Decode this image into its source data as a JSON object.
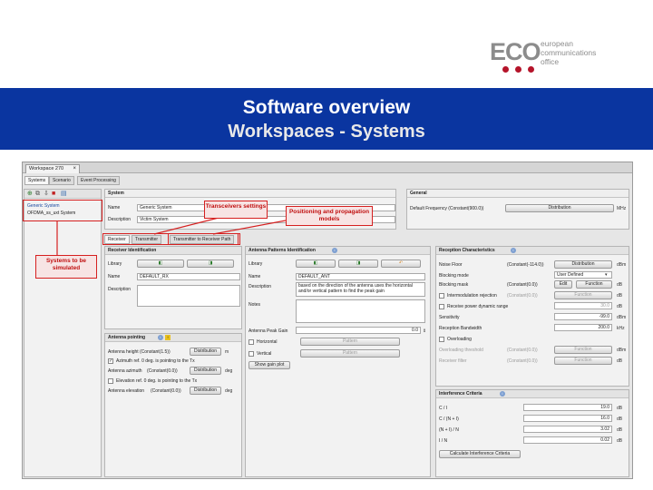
{
  "logo": {
    "mark": "ECO",
    "text_lines": [
      "european",
      "communications",
      "office"
    ],
    "brand_color": "#b5142a"
  },
  "banner": {
    "title": "Software overview",
    "subtitle": "Workspaces - Systems",
    "background_color": "#0a35a0"
  },
  "app": {
    "workspace_tab": "Workspace 270",
    "sub_tabs": [
      "Systems",
      "Scenario",
      "Event Processing"
    ],
    "systems_list": [
      "Generic System",
      "OFDMA_ss_uxt System"
    ],
    "system": {
      "header": "System",
      "name_label": "Name",
      "name_value": "Generic System",
      "description_label": "Description",
      "description_value": "Victim System"
    },
    "general": {
      "header": "General",
      "default_frequency_label": "Default Frequency (Constant(900.0))",
      "distribution_btn": "Distribution",
      "unit": "MHz"
    },
    "tabs": [
      "Receiver",
      "Transmitter",
      "Transmitter to Receiver Path"
    ],
    "receiver_identification": {
      "header": "Receiver Identification",
      "library_label": "Library",
      "name_label": "Name",
      "name_value": "DEFAULT_RX",
      "description_label": "Description"
    },
    "antenna_pattern": {
      "header": "Antenna Patterns Identification",
      "library_label": "Library",
      "name_label": "Name",
      "name_value": "DEFAULT_ANT",
      "description_label": "Description",
      "description_text": "based on the direction of the antenna uses the horizontal and/or vertical pattern to find the peak gain",
      "notes_label": "Notes",
      "peak_gain_label": "Antenna Peak Gain",
      "peak_gain_value": "0.0",
      "horizontal_label": "Horizontal",
      "vertical_label": "Vertical",
      "pattern_btn": "Pattern",
      "show_gain_btn": "Show gain plot"
    },
    "antenna_pointing": {
      "header": "Antenna pointing",
      "height_label": "Antenna height",
      "height_const": "(Constant(1.5))",
      "distribution_btn": "Distribution",
      "height_unit": "m",
      "azimuth_ref_label": "Azimuth ref. 0 deg. is pointing to the Tx",
      "azimuth_label": "Antenna azimuth",
      "azimuth_const": "(Constant(0.0))",
      "azimuth_unit": "deg",
      "elevation_ref_label": "Elevation ref. 0 deg. is pointing to the Tx",
      "elevation_label": "Antenna elevation",
      "elevation_const": "(Constant(0.0))",
      "elevation_unit": "deg"
    },
    "reception": {
      "header": "Reception Characteristics",
      "noise_floor_label": "Noise Floor",
      "noise_floor_const": "(Constant(-114.0))",
      "distribution_btn": "Distribution",
      "noise_floor_unit": "dBm",
      "blocking_mode_label": "Blocking mode",
      "blocking_mode_value": "User Defined",
      "blocking_mask_label": "Blocking mask",
      "blocking_mask_const": "(Constant(0.0))",
      "edit_btn": "Edit",
      "function_btn": "Function",
      "blocking_unit": "dB",
      "intermod_label": "Intermodulation rejection",
      "intermod_const": "(Constant(0.0))",
      "intermod_unit": "dB",
      "rx_power_label": "Receive power dynamic range",
      "rx_power_value": "30.0",
      "rx_power_unit": "dB",
      "sensitivity_label": "Sensitivity",
      "sensitivity_value": "-99.0",
      "sensitivity_unit": "dBm",
      "bandwidth_label": "Reception Bandwidth",
      "bandwidth_value": "200.0",
      "bandwidth_unit": "kHz",
      "overloading_label": "Overloading",
      "overload_threshold_label": "Overloading threshold",
      "overload_threshold_const": "(Constant(0.0))",
      "overload_unit": "dBm",
      "receiver_filter_label": "Receiver filter",
      "receiver_filter_const": "(Constant(0.0))",
      "filter_unit": "dB"
    },
    "interference": {
      "header": "Interference Criteria",
      "ci_label": "C / I",
      "ci_value": "19.0",
      "cni_label": "C / (N + I)",
      "cni_value": "16.0",
      "nin_label": "(N + I) / N",
      "nin_value": "3.02",
      "in_label": "I / N",
      "in_value": "0.02",
      "unit": "dB",
      "calculate_btn": "Calculate Interference Criteria"
    },
    "callouts": {
      "systems": "Systems to be simulated",
      "transceivers": "Transceivers settings",
      "propagation": "Positioning and propagation models"
    },
    "annotation_color": "#d62020"
  }
}
